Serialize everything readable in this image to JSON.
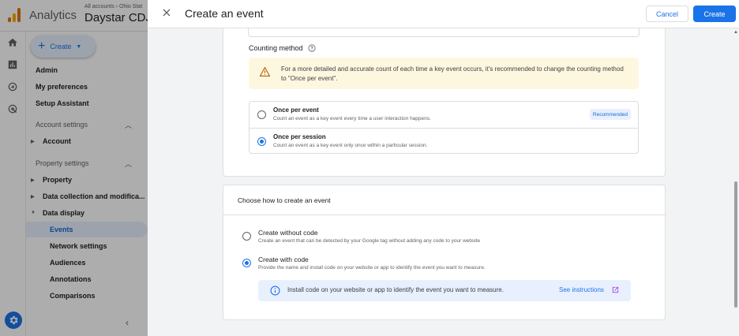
{
  "app": {
    "name": "Analytics",
    "breadcrumb": "All accounts › Ohio Stat",
    "property": "Daystar CDJR"
  },
  "nav": {
    "create_label": "Create",
    "items": [
      {
        "label": "Admin",
        "name": "nav-admin"
      },
      {
        "label": "My preferences",
        "name": "nav-my-preferences"
      },
      {
        "label": "Setup Assistant",
        "name": "nav-setup-assistant"
      }
    ],
    "account_settings": "Account settings",
    "account": "Account",
    "property_settings": "Property settings",
    "property": "Property",
    "data_collection": "Data collection and modifica...",
    "data_display": "Data display",
    "sub_items": [
      {
        "label": "Events",
        "name": "nav-events",
        "active": true
      },
      {
        "label": "Network settings",
        "name": "nav-network-settings"
      },
      {
        "label": "Audiences",
        "name": "nav-audiences"
      },
      {
        "label": "Annotations",
        "name": "nav-annotations"
      },
      {
        "label": "Comparisons",
        "name": "nav-comparisons"
      }
    ]
  },
  "dialog": {
    "title": "Create an event",
    "cancel_label": "Cancel",
    "create_label": "Create"
  },
  "counting": {
    "label": "Counting method",
    "warning": "For a more detailed and accurate count of each time a key event occurs, it's recommended to change the counting method to \"Once per event\".",
    "options": [
      {
        "title": "Once per event",
        "desc": "Count an event as a key event every time a user interaction happens.",
        "badge": "Recommended",
        "selected": false
      },
      {
        "title": "Once per session",
        "desc": "Count an event as a key event only once within a particular session.",
        "selected": true
      }
    ]
  },
  "how": {
    "title": "Choose how to create an event",
    "options": [
      {
        "title": "Create without code",
        "desc": "Create an event that can be detected by your Google tag without adding any code to your website",
        "selected": false
      },
      {
        "title": "Create with code",
        "desc": "Provide the name and install code on your website or app to identify the event you want to measure.",
        "selected": true
      }
    ],
    "info": "Install code on your website or app to identify the event you want to measure.",
    "link": "See instructions"
  },
  "colors": {
    "accent": "#1a73e8",
    "warning_bg": "#fef7e0",
    "info_bg": "#e8f0fe"
  }
}
